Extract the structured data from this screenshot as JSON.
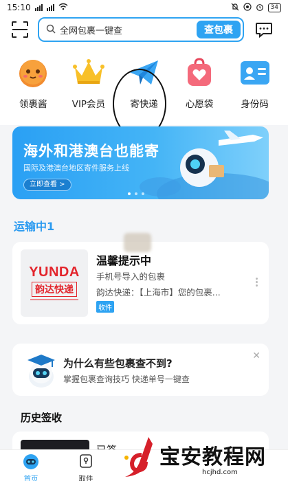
{
  "status": {
    "time": "15:10",
    "battery": "34"
  },
  "search": {
    "placeholder": "全网包裹一键查",
    "button": "查包裹"
  },
  "quick_actions": [
    {
      "label": "领裹酱",
      "icon": "mascot-face-icon"
    },
    {
      "label": "VIP会员",
      "icon": "crown-icon"
    },
    {
      "label": "寄快递",
      "icon": "paper-plane-icon"
    },
    {
      "label": "心愿袋",
      "icon": "wish-bag-icon"
    },
    {
      "label": "身份码",
      "icon": "id-card-icon"
    }
  ],
  "banner": {
    "title": "海外和港澳台也能寄",
    "subtitle": "国际及港澳台地区寄件服务上线",
    "button": "立即查看 >"
  },
  "in_transit": {
    "title": "运输中1"
  },
  "parcel": {
    "logo_en": "YUNDA",
    "logo_cn": "韵达快递",
    "title": "温馨提示中",
    "from": "手机号导入的包裹",
    "desc": "韵达快递：【上海市】您的包裹...",
    "tag": "收件"
  },
  "tip": {
    "title": "为什么有些包裹查不到?",
    "subtitle": "掌握包裹查询技巧 快递单号一键查"
  },
  "history": {
    "title": "历史签收",
    "item_text": "已签"
  },
  "nav": {
    "home": "首页",
    "pickup": "取件"
  },
  "watermark": {
    "text": "宝安教程网",
    "url": "hcjhd.com"
  },
  "colors": {
    "accent": "#2ea3f2",
    "brand_red": "#e3252c"
  }
}
